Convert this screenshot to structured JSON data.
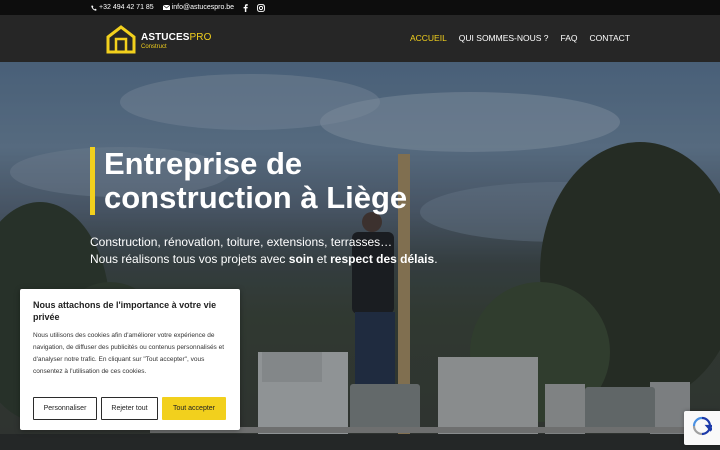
{
  "topbar": {
    "phone": "+32 494 42 71 85",
    "email": "info@astucespro.be",
    "social": [
      "facebook-icon",
      "instagram-icon"
    ]
  },
  "brand": {
    "name_main": "ASTUCES",
    "name_accent": "PRO",
    "sub": "Construct",
    "accent_color": "#f2d01d"
  },
  "nav": {
    "items": [
      {
        "label": "ACCUEIL",
        "active": true
      },
      {
        "label": "QUI SOMMES-NOUS ?",
        "active": false
      },
      {
        "label": "FAQ",
        "active": false
      },
      {
        "label": "CONTACT",
        "active": false
      }
    ]
  },
  "hero": {
    "title": "Entreprise de construction à Liège",
    "line1": "Construction, rénovation, toiture, extensions, terrasses…",
    "line2_prefix": "Nous réalisons tous vos projets avec ",
    "line2_bold1": "soin",
    "line2_mid": " et ",
    "line2_bold2": "respect des délais",
    "line2_suffix": "."
  },
  "cookie": {
    "title": "Nous attachons de l'importance à votre vie privée",
    "text": "Nous utilisons des cookies afin d'améliorer votre expérience de navigation, de diffuser des publicités ou contenus personnalisés et d'analyser notre trafic. En cliquant sur \"Tout accepter\", vous consentez à l'utilisation de ces cookies.",
    "buttons": {
      "customize": "Personnaliser",
      "reject": "Rejeter tout",
      "accept": "Tout accepter"
    }
  },
  "recaptcha": {
    "icon": "recaptcha-icon"
  }
}
